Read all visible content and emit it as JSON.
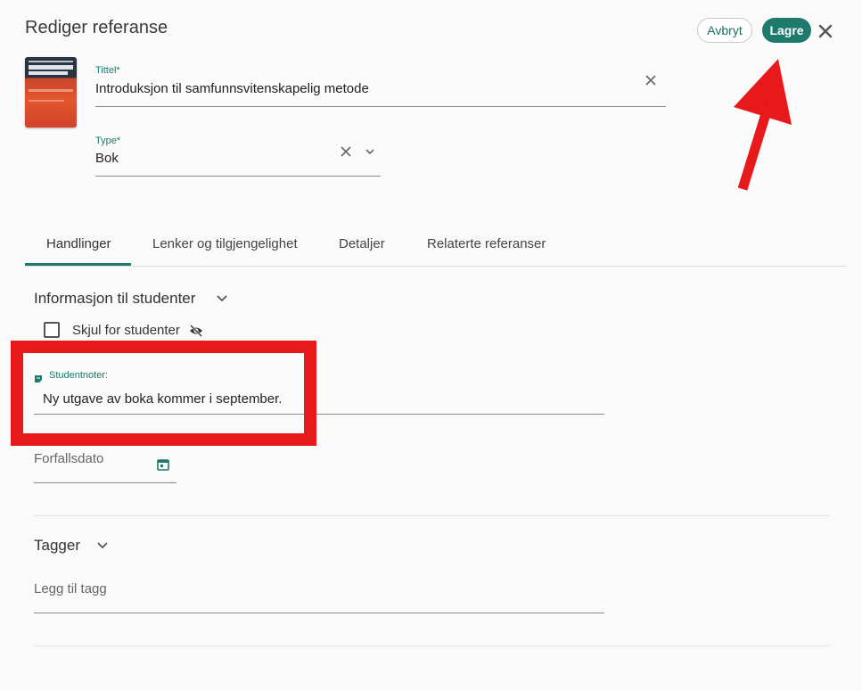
{
  "header": {
    "title": "Rediger referanse",
    "cancel_label": "Avbryt",
    "save_label": "Lagre"
  },
  "form": {
    "title_field": {
      "label": "Tittel*",
      "value": "Introduksjon til samfunnsvitenskapelig metode"
    },
    "type_field": {
      "label": "Type*",
      "value": "Bok"
    }
  },
  "tabs": [
    {
      "label": "Handlinger",
      "active": true
    },
    {
      "label": "Lenker og tilgjengelighet",
      "active": false
    },
    {
      "label": "Detaljer",
      "active": false
    },
    {
      "label": "Relaterte referanser",
      "active": false
    }
  ],
  "student_info": {
    "title": "Informasjon til studenter",
    "hide_label": "Skjul for studenter",
    "hide_checked": false,
    "notes_label": "Studentnoter:",
    "notes_value": "Ny utgave av boka kommer i september.",
    "due_label": "Forfallsdato"
  },
  "tags": {
    "title": "Tagger",
    "placeholder": "Legg til tagg"
  },
  "colors": {
    "accent": "#1d7a6c",
    "annotation": "#e8191b"
  },
  "icons": {
    "close": "close-icon",
    "clear": "clear-icon",
    "dropdown": "chevron-down-icon",
    "hidden": "eye-off-icon",
    "note": "note-icon",
    "calendar": "calendar-icon"
  }
}
